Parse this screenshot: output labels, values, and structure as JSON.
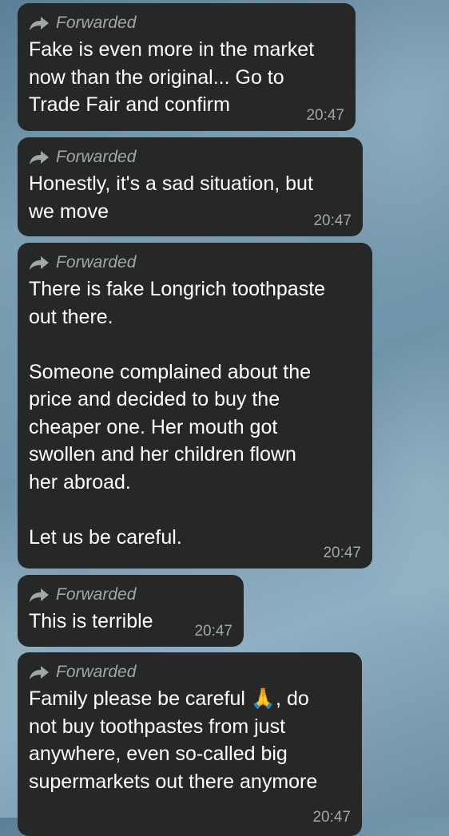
{
  "messages": [
    {
      "forwarded_label": "Forwarded",
      "text": "Fake is even more in the market\nnow than the original... Go to\nTrade Fair and confirm",
      "time": "20:47"
    },
    {
      "forwarded_label": "Forwarded",
      "text": "Honestly, it's a sad situation, but\nwe move",
      "time": "20:47"
    },
    {
      "forwarded_label": "Forwarded",
      "text": "There is fake Longrich toothpaste\nout there.\n\nSomeone complained about the\nprice and decided to buy the\ncheaper one. Her mouth got\nswollen and her children flown\nher abroad.\n\nLet us be careful.",
      "time": "20:47"
    },
    {
      "forwarded_label": "Forwarded",
      "text": "This is terrible",
      "time": "20:47"
    },
    {
      "forwarded_label": "Forwarded",
      "text_before_emoji": "Family please be careful ",
      "emoji": "🙏",
      "text_after_emoji": ", do\nnot buy toothpastes from just\nanywhere, even so-called big\nsupermarkets out there anymore",
      "time": "20:47"
    }
  ],
  "icons": {
    "forward": "forward-arrow-icon"
  }
}
